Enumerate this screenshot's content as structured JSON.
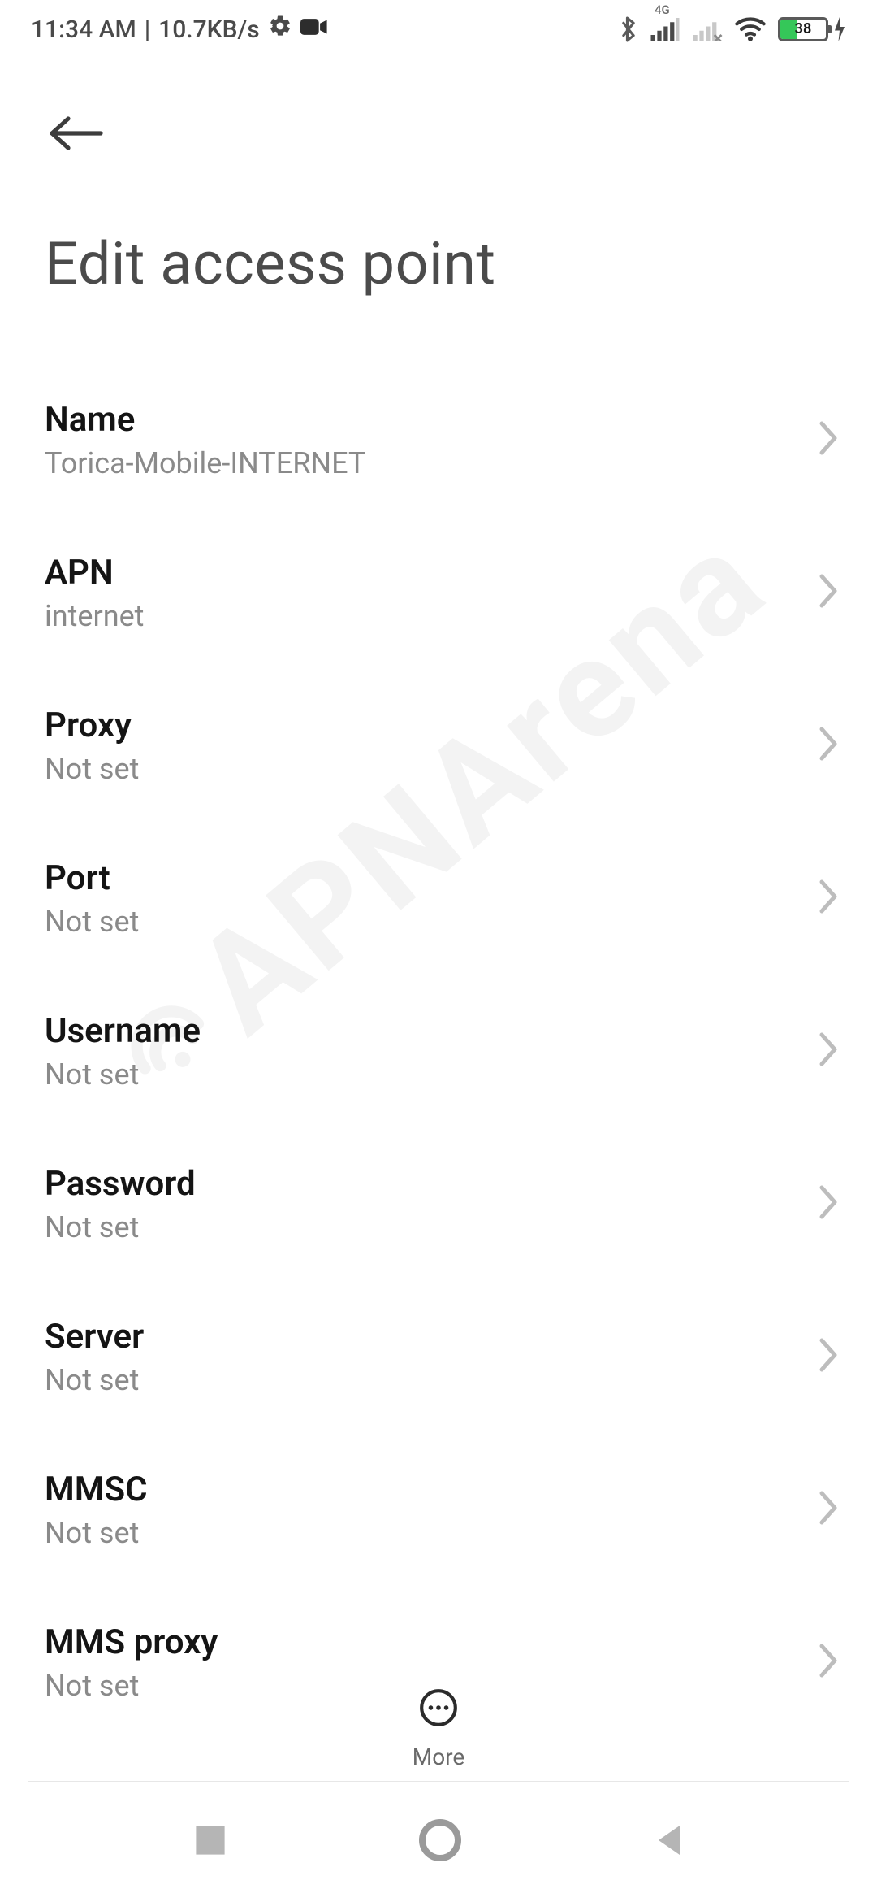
{
  "status": {
    "time": "11:34 AM",
    "sep": "|",
    "data_rate": "10.7KB/s",
    "network_label": "4G",
    "battery_pct": 38
  },
  "page": {
    "title": "Edit access point"
  },
  "rows": [
    {
      "label": "Name",
      "value": "Torica-Mobile-INTERNET"
    },
    {
      "label": "APN",
      "value": "internet"
    },
    {
      "label": "Proxy",
      "value": "Not set"
    },
    {
      "label": "Port",
      "value": "Not set"
    },
    {
      "label": "Username",
      "value": "Not set"
    },
    {
      "label": "Password",
      "value": "Not set"
    },
    {
      "label": "Server",
      "value": "Not set"
    },
    {
      "label": "MMSC",
      "value": "Not set"
    },
    {
      "label": "MMS proxy",
      "value": "Not set"
    }
  ],
  "bottom": {
    "more_label": "More"
  },
  "watermark": {
    "text": "APNArena"
  }
}
